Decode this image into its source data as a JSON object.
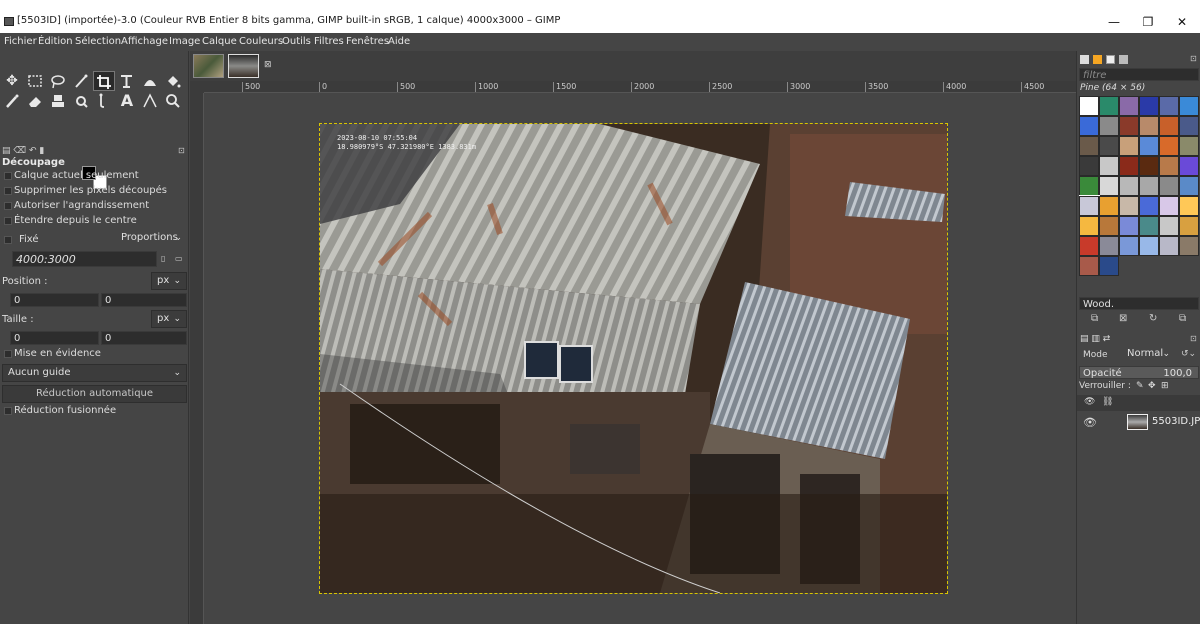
{
  "window": {
    "title": "[5503ID] (importée)-3.0 (Couleur RVB Entier 8 bits gamma, GIMP built-in sRGB, 1 calque) 4000x3000 – GIMP",
    "minimize": "—",
    "maximize": "❐",
    "close": "✕"
  },
  "menu": [
    "Fichier",
    "Édition",
    "Sélection",
    "Affichage",
    "Image",
    "Calque",
    "Couleurs",
    "Outils",
    "Filtres",
    "Fenêtres",
    "Aide"
  ],
  "tool_options": {
    "title": "Découpage",
    "current_layer_only": "Calque actuel seulement",
    "delete_cropped": "Supprimer les pixels découpés",
    "allow_growing": "Autoriser l'agrandissement",
    "expand_center": "Étendre depuis le centre",
    "fixed_label": "Fixé",
    "fixed_mode": "Proportions",
    "ratio_value": "4000:3000",
    "position_label": "Position :",
    "position_unit": "px",
    "position_x": "0",
    "position_y": "0",
    "size_label": "Taille :",
    "size_unit": "px",
    "size_w": "0",
    "size_h": "0",
    "highlight": "Mise en évidence",
    "guide": "Aucun guide",
    "auto_shrink": "Réduction automatique",
    "shrink_merged": "Réduction fusionnée"
  },
  "ruler_labels": [
    "500",
    "0",
    "500",
    "1000",
    "1500",
    "2000",
    "2500",
    "3000",
    "3500",
    "4000",
    "4500"
  ],
  "image": {
    "timestamp": "2023-08-10 07:55:04",
    "gps": "18.980979°S 47.321980°E 1383.831m"
  },
  "patterns": {
    "filter_placeholder": "filtre",
    "current": "Pine (64 × 56)",
    "name_field": "Wood."
  },
  "layers": {
    "mode_label": "Mode",
    "mode_value": "Normal",
    "opacity_label": "Opacité",
    "opacity_value": "100,0",
    "lock_label": "Verrouiller :",
    "layer_name": "5503ID.JP"
  },
  "colors": {
    "panel_bg": "#454545",
    "selection_dash": "#d9c400",
    "active_pattern": "#ffc857"
  }
}
